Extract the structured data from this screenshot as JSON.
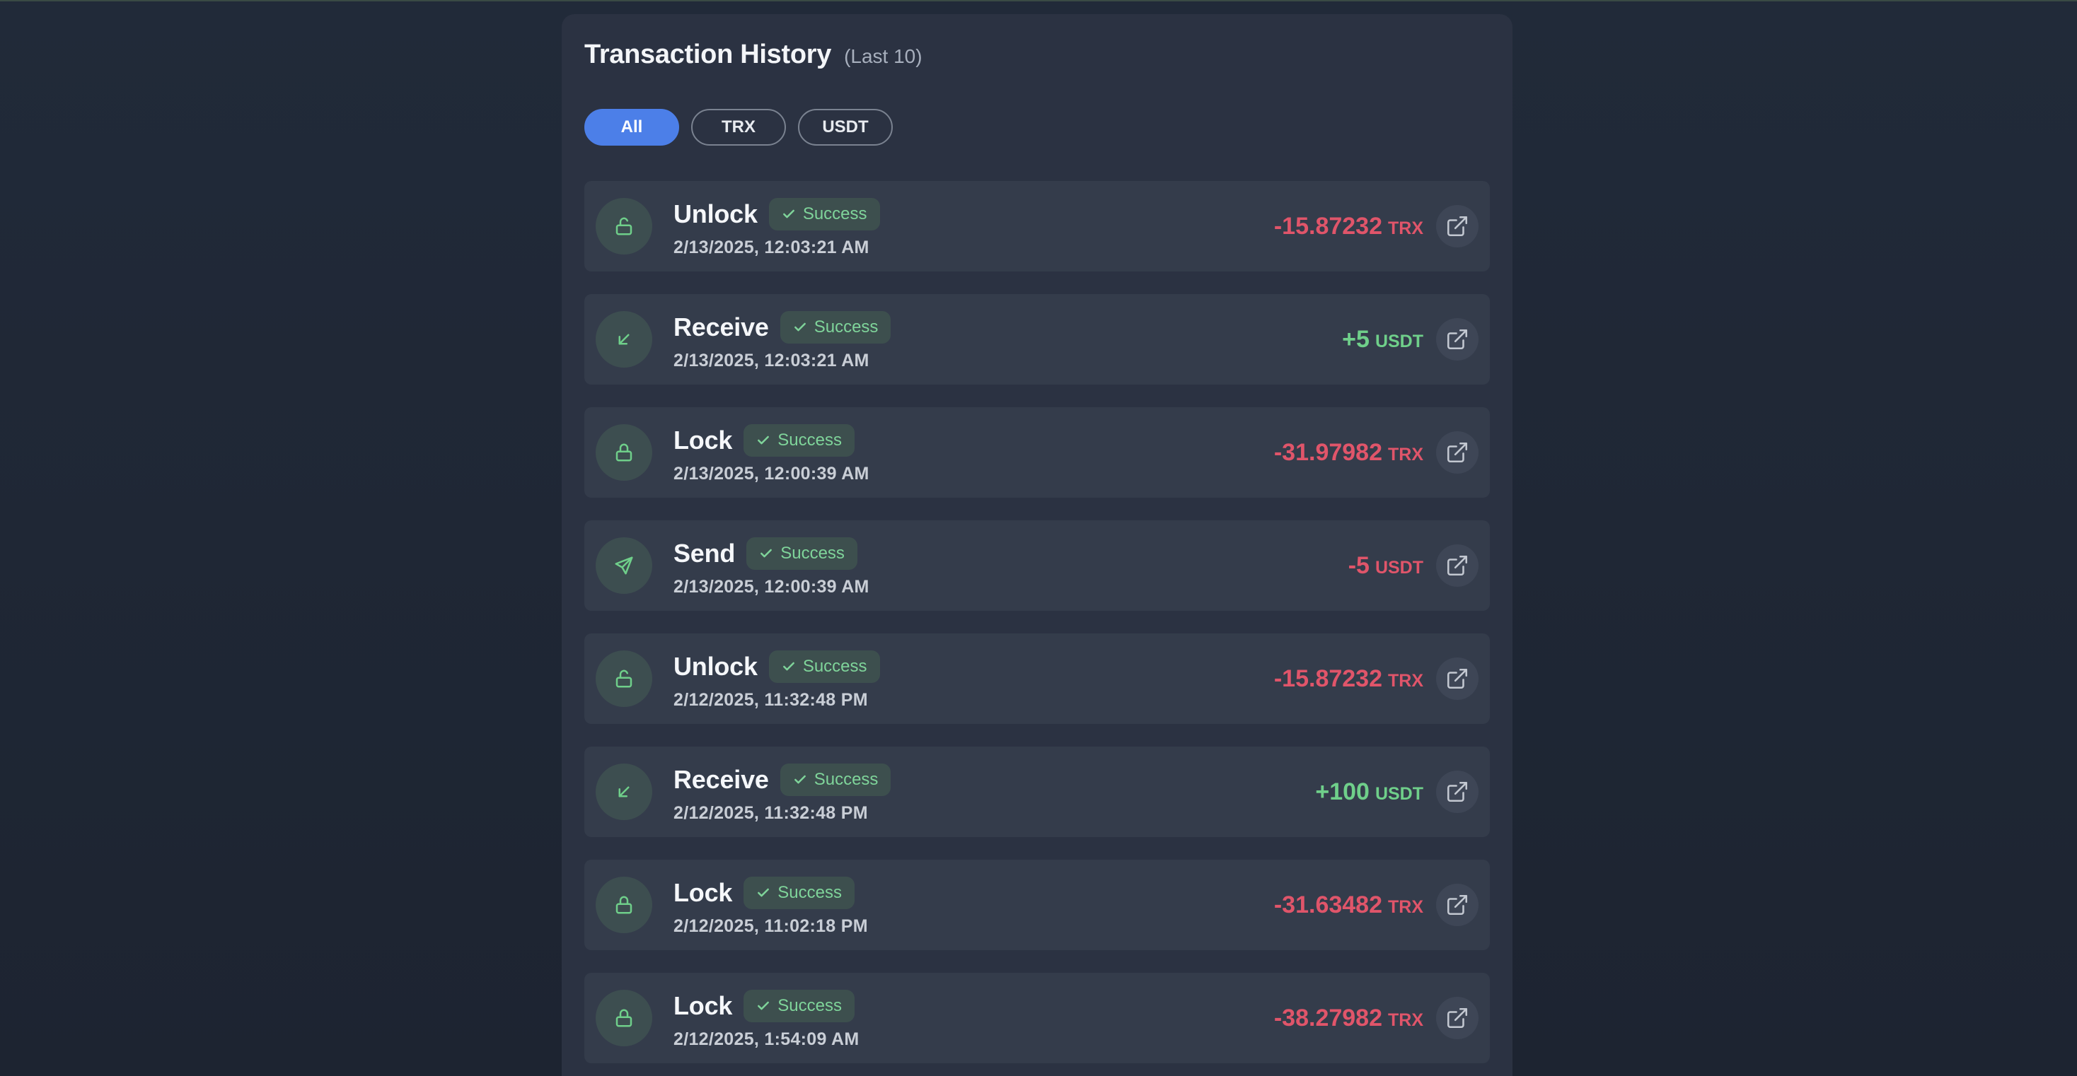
{
  "header": {
    "title": "Transaction History",
    "subtitle": "(Last 10)"
  },
  "filters": [
    {
      "label": "All",
      "active": true
    },
    {
      "label": "TRX",
      "active": false
    },
    {
      "label": "USDT",
      "active": false
    }
  ],
  "transactions": [
    {
      "type": "Unlock",
      "icon": "unlock-icon",
      "status": "Success",
      "date": "2/13/2025, 12:03:21 AM",
      "amount": "-15.87232",
      "unit": "TRX",
      "sign": "negative"
    },
    {
      "type": "Receive",
      "icon": "arrow-down-left-icon",
      "status": "Success",
      "date": "2/13/2025, 12:03:21 AM",
      "amount": "+5",
      "unit": "USDT",
      "sign": "positive"
    },
    {
      "type": "Lock",
      "icon": "lock-icon",
      "status": "Success",
      "date": "2/13/2025, 12:00:39 AM",
      "amount": "-31.97982",
      "unit": "TRX",
      "sign": "negative"
    },
    {
      "type": "Send",
      "icon": "send-icon",
      "status": "Success",
      "date": "2/13/2025, 12:00:39 AM",
      "amount": "-5",
      "unit": "USDT",
      "sign": "negative"
    },
    {
      "type": "Unlock",
      "icon": "unlock-icon",
      "status": "Success",
      "date": "2/12/2025, 11:32:48 PM",
      "amount": "-15.87232",
      "unit": "TRX",
      "sign": "negative"
    },
    {
      "type": "Receive",
      "icon": "arrow-down-left-icon",
      "status": "Success",
      "date": "2/12/2025, 11:32:48 PM",
      "amount": "+100",
      "unit": "USDT",
      "sign": "positive"
    },
    {
      "type": "Lock",
      "icon": "lock-icon",
      "status": "Success",
      "date": "2/12/2025, 11:02:18 PM",
      "amount": "-31.63482",
      "unit": "TRX",
      "sign": "negative"
    },
    {
      "type": "Lock",
      "icon": "lock-icon",
      "status": "Success",
      "date": "2/12/2025, 1:54:09 AM",
      "amount": "-38.27982",
      "unit": "TRX",
      "sign": "negative"
    }
  ],
  "colors": {
    "accent": "#4c7fe8",
    "negative": "#e0556a",
    "positive": "#6fcf8a",
    "badge_text": "#7fd49a"
  }
}
